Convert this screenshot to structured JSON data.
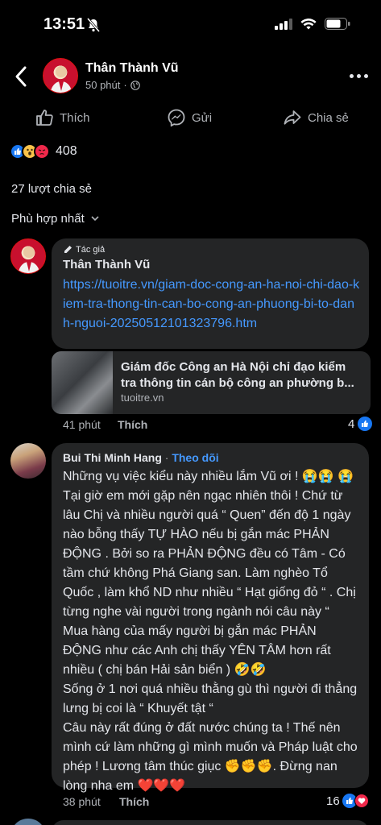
{
  "status_bar": {
    "time": "13:51"
  },
  "header": {
    "name": "Thân Thành Vũ",
    "time": "50 phút"
  },
  "actions": {
    "like": "Thích",
    "send": "Gửi",
    "share": "Chia sẻ"
  },
  "reactions": {
    "count": "408"
  },
  "shares": "27 lượt chia sẻ",
  "sort": "Phù hợp nhất",
  "comment1": {
    "author_tag": "Tác giả",
    "name": "Thân Thành Vũ",
    "link": "https://tuoitre.vn/giam-doc-cong-an-ha-noi-chi-dao-kiem-tra-thong-tin-can-bo-cong-an-phuong-bi-to-danh-nguoi-20250512101323796.htm",
    "preview_title": "Giám đốc Công an Hà Nội chỉ đạo kiểm tra thông tin cán bộ công an phường b...",
    "preview_domain": "tuoitre.vn",
    "time": "41 phút",
    "like": "Thích",
    "react_count": "4"
  },
  "comment2": {
    "name": "Bui Thi Minh Hang",
    "separator": " · ",
    "follow": "Theo dõi",
    "text": "Những vụ việc kiểu này nhiều lắm Vũ ơi ! 😭😭 😭\nTại giờ em mới gặp nên ngạc nhiên thôi ! Chứ từ lâu Chị và nhiều người quá “ Quen” đến độ 1 ngày nào bỗng thấy TỰ HÀO nếu bị gắn mác PHẢN ĐỘNG . Bởi so ra PHẢN ĐỘNG đều có Tâm - Có tầm chứ không Phá Giang san. Làm nghèo Tổ Quốc , làm khổ ND như nhiều “ Hạt giống đỏ “ . Chị từng nghe vài người trong ngành nói câu này “ Mua hàng của mấy người bị gắn mác PHẢN ĐỘNG như các Anh chị thấy YÊN TÂM hơn rất nhiều ( chị bán Hải sản biển ) 🤣🤣\nSống ở 1 nơi quá nhiều thằng gù thì người đi thẳng lưng bị coi là “ Khuyết tật “\nCâu này rất đúng ở đất nước chúng ta ! Thế nên mình cứ làm những gì mình muốn và Pháp luật cho phép ! Lương tâm thúc giục ✊✊✊. Đừng nan lòng nha em ❤️❤️❤️",
    "time": "38 phút",
    "like": "Thích",
    "react_count": "16"
  },
  "colors": {
    "link": "#4599ff",
    "bubble": "#242526",
    "like_blue": "#1877f2",
    "angry": "#f0284a"
  }
}
